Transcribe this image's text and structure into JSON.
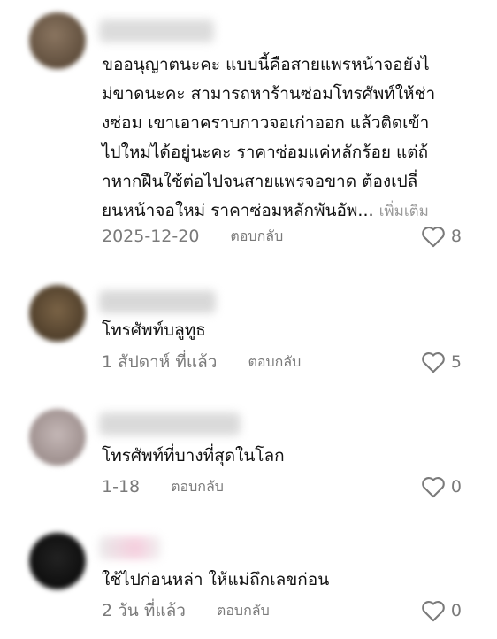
{
  "comments": [
    {
      "body_lines": [
        "ขออนุญาตนะคะ แบบนี้คือสายแพรหน้าจอยังไ",
        "ม่ขาดนะคะ สามารถหาร้านซ่อมโทรศัพท์ให้ช่า",
        "งซ่อม เขาเอาคราบกาวจอเก่าออก แล้วติดเข้า",
        "ไปใหม่ได้อยู่นะคะ ราคาซ่อมแค่หลักร้อย แต่ถ้",
        "าหากฝืนใช้ต่อไปจนสายแพรจอขาด ต้องเปลี่",
        "ยนหน้าจอใหม่ ราคาซ่อมหลักพันอัพ..."
      ],
      "more_label": "เพิ่มเติม",
      "date": "2025-12-20",
      "reply_label": "ตอบกลับ",
      "likes": "8",
      "avatar_color": "#6e5a45"
    },
    {
      "body_lines": [
        "โทรศัพท์บลูทูธ"
      ],
      "date": "1 สัปดาห์ ที่แล้ว",
      "reply_label": "ตอบกลับ",
      "likes": "5",
      "avatar_color": "#5e4a34"
    },
    {
      "body_lines": [
        "โทรศัพท์ที่บางที่สุดในโลก"
      ],
      "date": "1-18",
      "reply_label": "ตอบกลับ",
      "likes": "0",
      "avatar_color": "#a89a98"
    },
    {
      "body_lines": [
        "ใช้ไปก่อนหล่า ให้แม่ถึกเลขก่อน"
      ],
      "date": "2 วัน ที่แล้ว",
      "reply_label": "ตอบกลับ",
      "likes": "0",
      "avatar_color": "#111111"
    }
  ],
  "icons": {
    "like": "heart-outline-icon"
  }
}
